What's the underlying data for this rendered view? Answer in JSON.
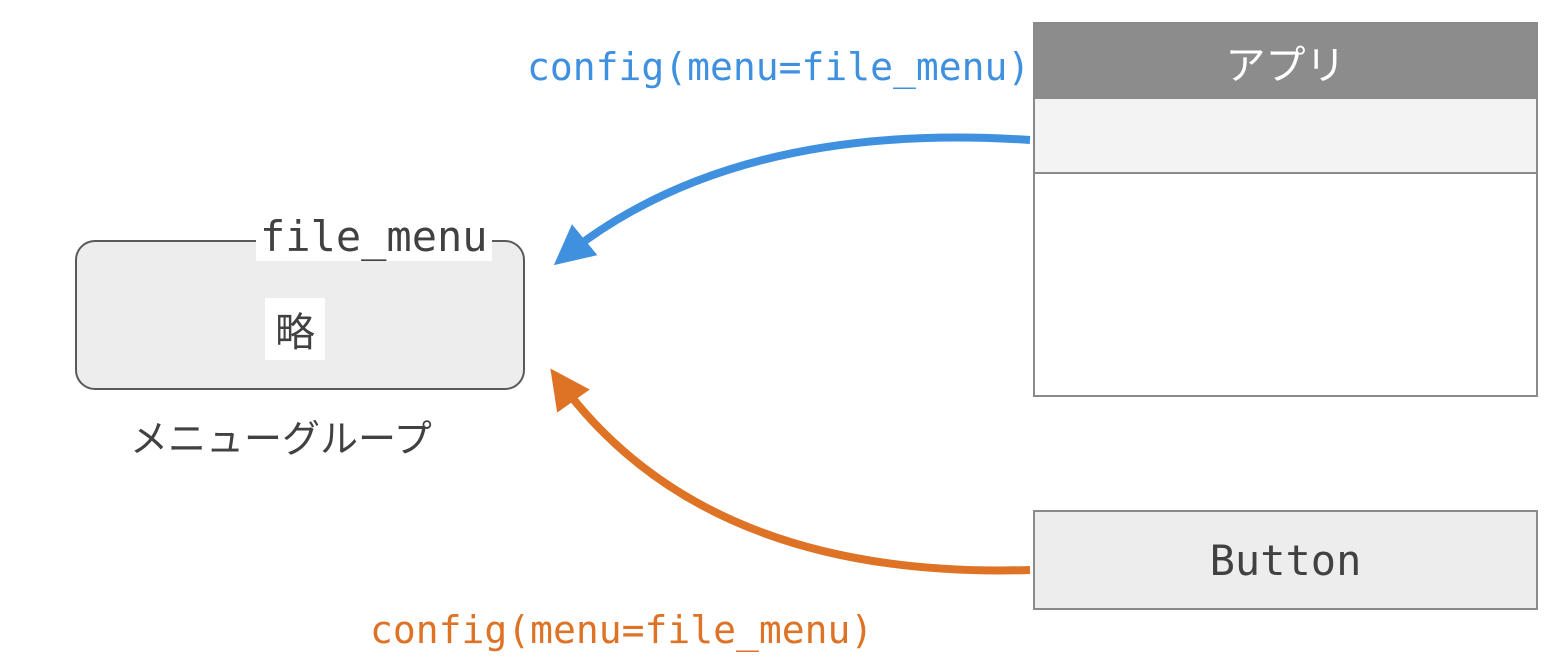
{
  "file_menu": {
    "title": "file_menu",
    "inner": "略",
    "caption": "メニューグループ"
  },
  "app": {
    "title": "アプリ"
  },
  "button": {
    "label": "Button"
  },
  "labels": {
    "top": "config(menu=file_menu)",
    "bottom": "config(menu=file_menu)"
  },
  "colors": {
    "blue": "#3f90df",
    "orange": "#de7326",
    "grey_border": "#8a8a8a",
    "grey_fill": "#ededed",
    "titlebar": "#8c8c8c"
  }
}
